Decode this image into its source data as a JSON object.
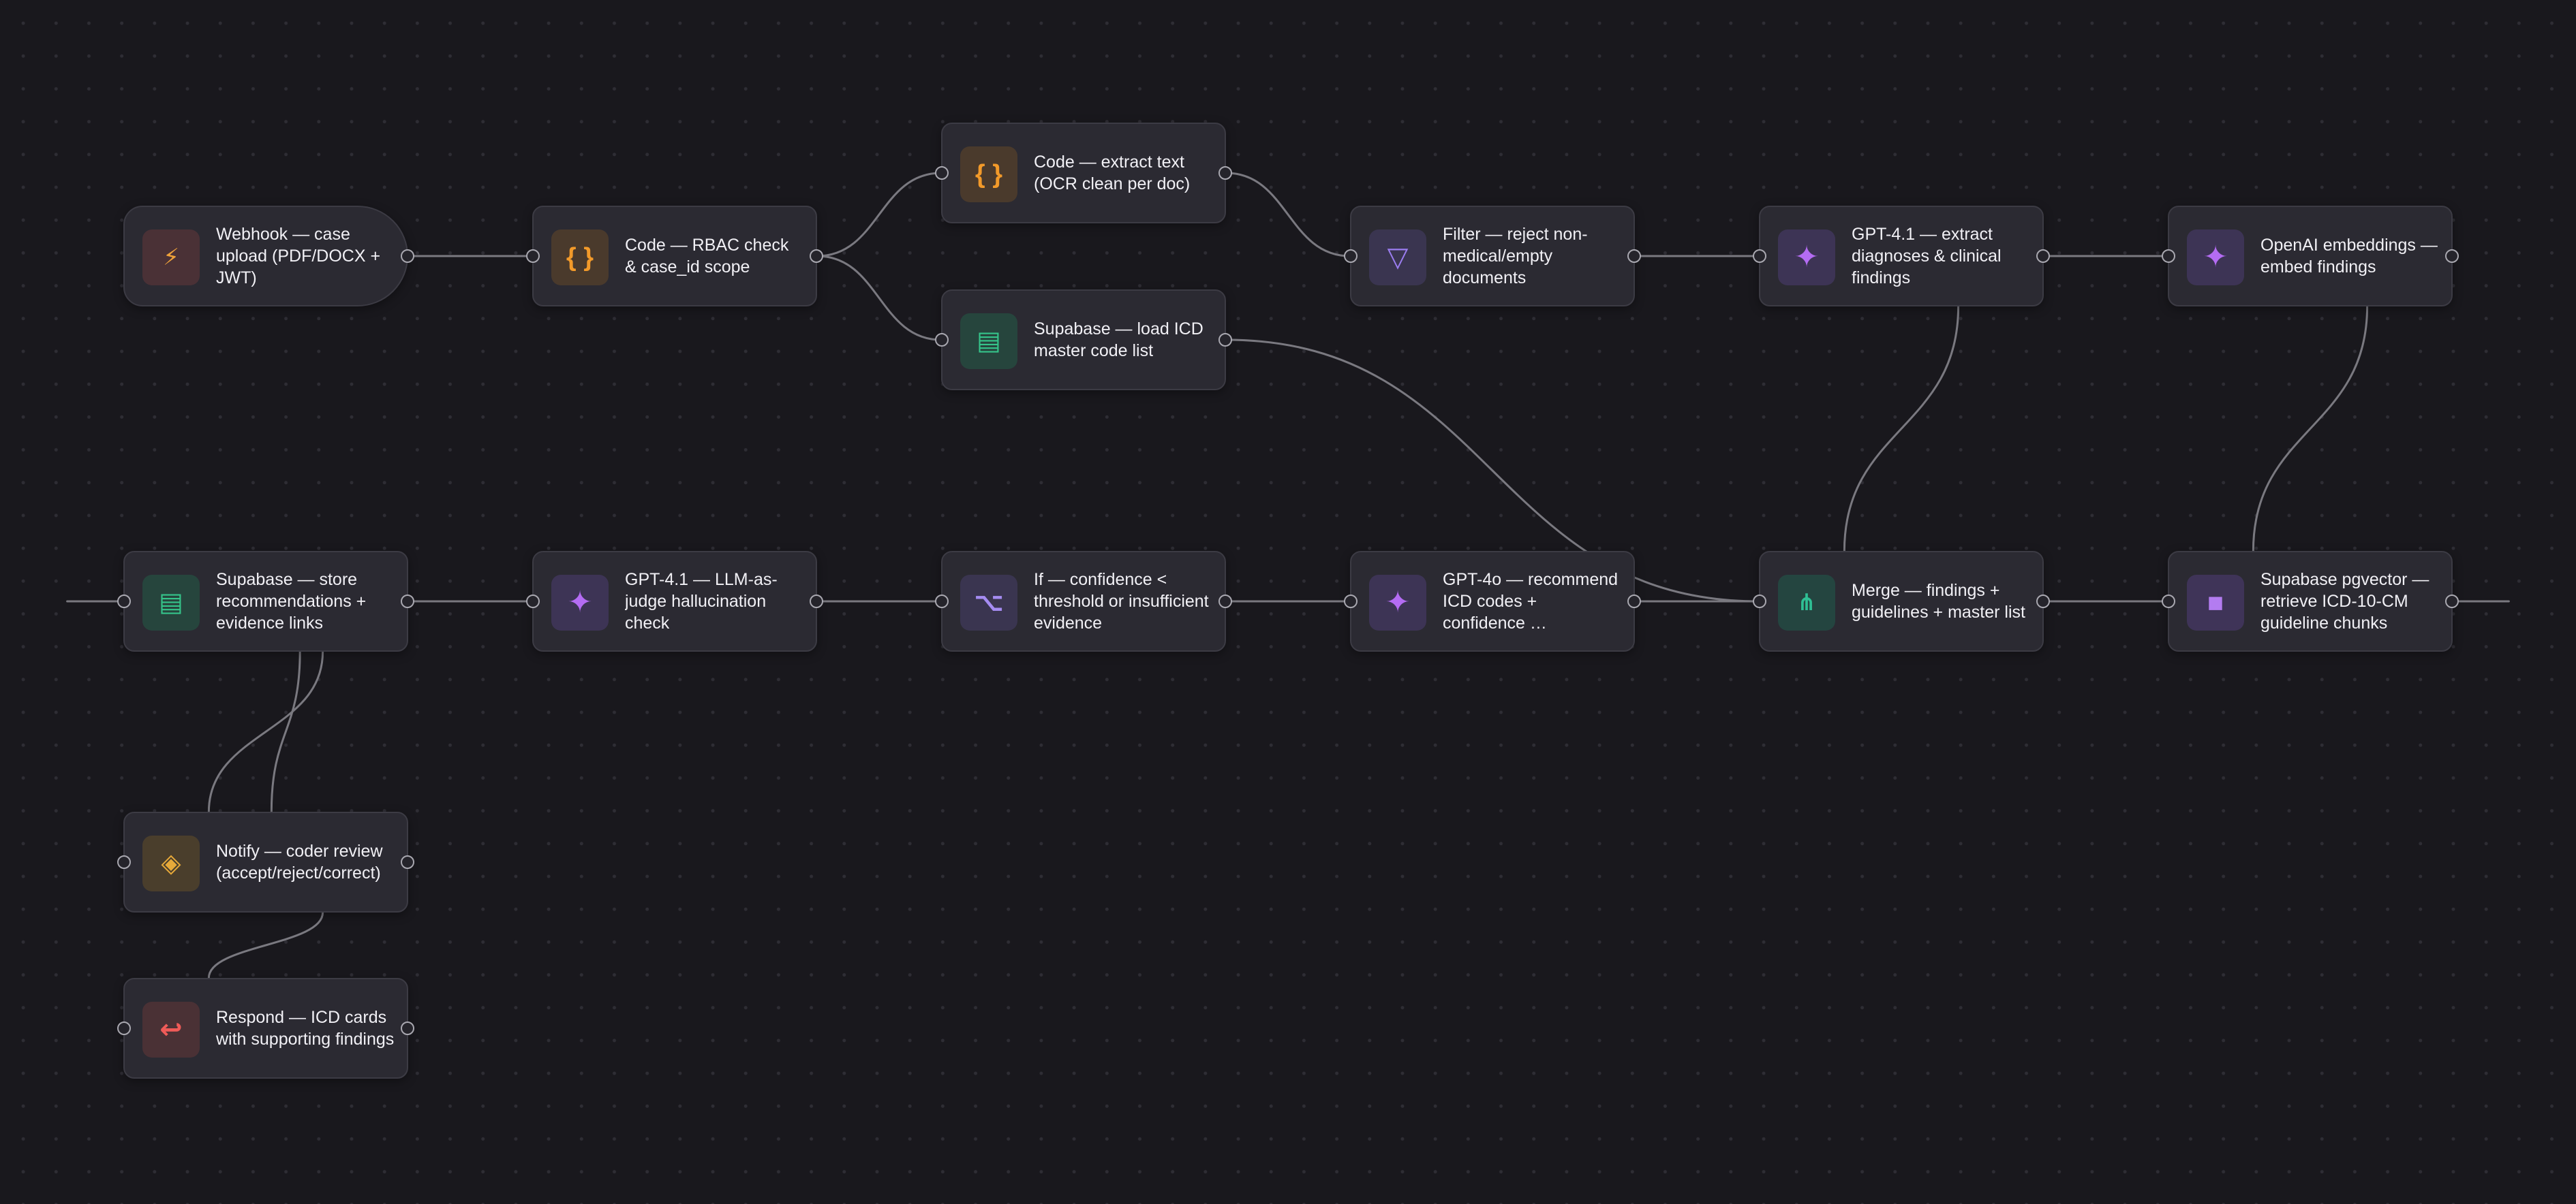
{
  "canvas": {
    "background": "#19181d",
    "edge_color": "#7a7980"
  },
  "nodes": [
    {
      "id": "webhook",
      "title": "Webhook — case upload (PDF/DOCX + JWT)",
      "icon": "lightning-icon",
      "icon_glyph": "⚡",
      "icon_class": "ic-webhook",
      "type": "trigger"
    },
    {
      "id": "rbac",
      "title": "Code — RBAC check & case_id scope",
      "icon": "code-braces-icon",
      "icon_glyph": "{ }",
      "icon_class": "ic-code",
      "type": "code"
    },
    {
      "id": "extract_text",
      "title": "Code — extract text (OCR clean per doc)",
      "icon": "code-braces-icon",
      "icon_glyph": "{ }",
      "icon_class": "ic-code",
      "type": "code"
    },
    {
      "id": "load_icd",
      "title": "Supabase — load ICD master code list",
      "icon": "database-icon",
      "icon_glyph": "▤",
      "icon_class": "ic-db",
      "type": "supabase"
    },
    {
      "id": "filter",
      "title": "Filter — reject non-medical/empty documents",
      "icon": "filter-icon",
      "icon_glyph": "▽",
      "icon_class": "ic-filter",
      "type": "filter"
    },
    {
      "id": "gpt41_extract",
      "title": "GPT-4.1 — extract diagnoses & clinical findings",
      "icon": "sparkle-icon",
      "icon_glyph": "✦",
      "icon_class": "ic-ai",
      "type": "ai"
    },
    {
      "id": "embeddings",
      "title": "OpenAI embeddings — embed findings",
      "icon": "sparkle-icon",
      "icon_glyph": "✦",
      "icon_class": "ic-ai",
      "type": "ai"
    },
    {
      "id": "store",
      "title": "Supabase — store recommendations + evidence links",
      "icon": "database-icon",
      "icon_glyph": "▤",
      "icon_class": "ic-db",
      "type": "supabase"
    },
    {
      "id": "judge",
      "title": "GPT-4.1 — LLM-as-judge hallucination check",
      "icon": "sparkle-icon",
      "icon_glyph": "✦",
      "icon_class": "ic-ai",
      "type": "ai"
    },
    {
      "id": "if_conf",
      "title": "If — confidence < threshold or insufficient evidence",
      "icon": "branch-icon",
      "icon_glyph": "⌥",
      "icon_class": "ic-if",
      "type": "if"
    },
    {
      "id": "gpt4o",
      "title": "GPT-4o — recommend ICD codes + confidence …",
      "icon": "sparkle-icon",
      "icon_glyph": "✦",
      "icon_class": "ic-ai",
      "type": "ai"
    },
    {
      "id": "merge",
      "title": "Merge — findings + guidelines + master list",
      "icon": "merge-icon",
      "icon_glyph": "⋔",
      "icon_class": "ic-merge",
      "type": "merge"
    },
    {
      "id": "pgvector",
      "title": "Supabase pgvector — retrieve ICD-10-CM guideline chunks",
      "icon": "vector-store-icon",
      "icon_glyph": "■",
      "icon_class": "ic-vector",
      "type": "vector"
    },
    {
      "id": "notify",
      "title": "Notify — coder review (accept/reject/correct)",
      "icon": "diamond-icon",
      "icon_glyph": "◈",
      "icon_class": "ic-notify",
      "type": "notify"
    },
    {
      "id": "respond",
      "title": "Respond — ICD cards with supporting findings",
      "icon": "return-arrow-icon",
      "icon_glyph": "↩",
      "icon_class": "ic-respond",
      "type": "respond"
    }
  ],
  "edges": [
    {
      "from": "webhook",
      "to": "rbac",
      "kind": "flow"
    },
    {
      "from": "rbac",
      "to": "extract_text",
      "kind": "flow"
    },
    {
      "from": "rbac",
      "to": "load_icd",
      "kind": "flow"
    },
    {
      "from": "extract_text",
      "to": "filter",
      "kind": "flow"
    },
    {
      "from": "filter",
      "to": "gpt41_extract",
      "kind": "flow"
    },
    {
      "from": "gpt41_extract",
      "to": "embeddings",
      "kind": "flow"
    },
    {
      "from": "load_icd",
      "to": "merge",
      "kind": "flow"
    },
    {
      "from": "gpt41_extract",
      "to": "merge",
      "kind": "sub"
    },
    {
      "from": "embeddings",
      "to": "pgvector",
      "kind": "sub"
    },
    {
      "from": "pgvector",
      "to": "merge",
      "kind": "flow"
    },
    {
      "from": "merge",
      "to": "gpt4o",
      "kind": "flow"
    },
    {
      "from": "gpt4o",
      "to": "if_conf",
      "kind": "flow"
    },
    {
      "from": "if_conf",
      "to": "judge",
      "kind": "flow"
    },
    {
      "from": "judge",
      "to": "store",
      "kind": "flow"
    },
    {
      "from": "store",
      "to": "notify",
      "kind": "sub"
    },
    {
      "from": "store",
      "to": "notify",
      "kind": "sub2"
    },
    {
      "from": "notify",
      "to": "respond",
      "kind": "sub"
    }
  ]
}
